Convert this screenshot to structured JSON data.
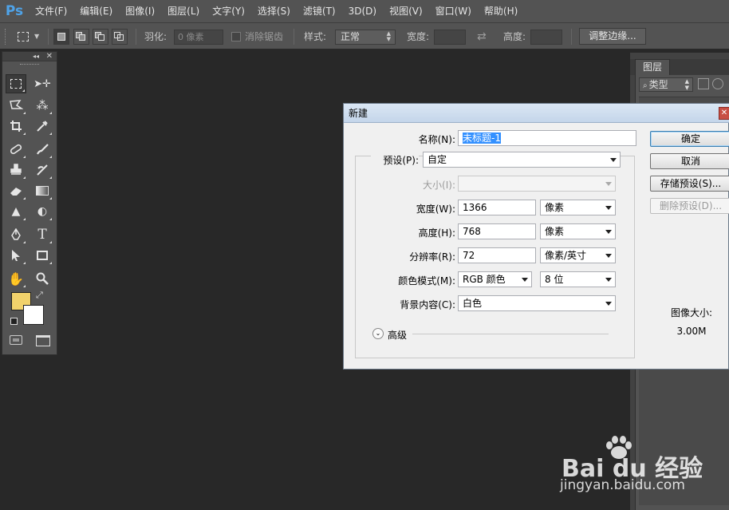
{
  "app": {
    "logo": "Ps",
    "menu": [
      "文件(F)",
      "编辑(E)",
      "图像(I)",
      "图层(L)",
      "文字(Y)",
      "选择(S)",
      "滤镜(T)",
      "3D(D)",
      "视图(V)",
      "窗口(W)",
      "帮助(H)"
    ]
  },
  "options_bar": {
    "feather_label": "羽化:",
    "feather_value": "0 像素",
    "antialias_label": "消除锯齿",
    "style_label": "样式:",
    "style_value": "正常",
    "width_label": "宽度:",
    "height_label": "高度:",
    "refine_edge_button": "调整边缘..."
  },
  "tools": {
    "foreground_color": "#f2d26b",
    "background_color": "#ffffff",
    "type_glyph": "T"
  },
  "layers_panel": {
    "tab": "图层",
    "filter_label": "类型"
  },
  "dialog": {
    "title": "新建",
    "name_label": "名称(N):",
    "name_value": "未标题-1",
    "preset_label": "预设(P):",
    "preset_value": "自定",
    "size_label": "大小(I):",
    "width_label": "宽度(W):",
    "width_value": "1366",
    "width_unit": "像素",
    "height_label": "高度(H):",
    "height_value": "768",
    "height_unit": "像素",
    "resolution_label": "分辨率(R):",
    "resolution_value": "72",
    "resolution_unit": "像素/英寸",
    "color_mode_label": "颜色模式(M):",
    "color_mode_value": "RGB 颜色",
    "bit_depth_value": "8 位",
    "background_label": "背景内容(C):",
    "background_value": "白色",
    "advanced_label": "高级",
    "ok_button": "确定",
    "cancel_button": "取消",
    "save_preset_button": "存储预设(S)...",
    "delete_preset_button": "删除预设(D)...",
    "image_size_label": "图像大小:",
    "image_size_value": "3.00M"
  },
  "watermark": {
    "main": "Bai du 经验",
    "sub": "jingyan.baidu.com"
  }
}
